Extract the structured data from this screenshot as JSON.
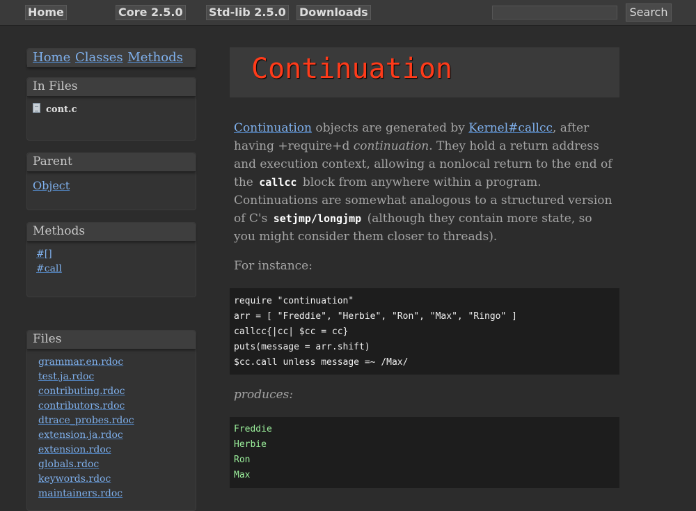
{
  "nav": {
    "home": "Home",
    "core": "Core 2.5.0",
    "stdlib": "Std-lib 2.5.0",
    "downloads": "Downloads",
    "search_button": "Search",
    "search_placeholder": ""
  },
  "sidebar": {
    "navlinks": {
      "home": "Home",
      "classes": "Classes",
      "methods": "Methods"
    },
    "in_files": {
      "title": "In Files",
      "file": "cont.c"
    },
    "parent": {
      "title": "Parent",
      "link": "Object"
    },
    "methods": {
      "title": "Methods",
      "items": [
        "#[]",
        "#call"
      ]
    },
    "files": {
      "title": "Files",
      "items": [
        "grammar.en.rdoc",
        "test.ja.rdoc",
        "contributing.rdoc",
        "contributors.rdoc",
        "dtrace_probes.rdoc",
        "extension.ja.rdoc",
        "extension.rdoc",
        "globals.rdoc",
        "keywords.rdoc",
        "maintainers.rdoc"
      ]
    }
  },
  "main": {
    "title": "Continuation",
    "desc": {
      "link1": "Continuation",
      "t1": " objects are generated by ",
      "link2": "Kernel#callcc",
      "t2": ", after having +require+d ",
      "em": "continuation",
      "t3": ". They hold a return address and execution context, allowing a nonlocal return to the end of the ",
      "code1": "callcc",
      "t4": " block from anywhere within a program. Continuations are somewhat analogous to a structured version of C's ",
      "code2": "setjmp/longjmp",
      "t5": " (although they contain more state, so you might consider them closer to threads)."
    },
    "for_instance": "For instance:",
    "code_lines": [
      "require \"continuation\"",
      "arr = [ \"Freddie\", \"Herbie\", \"Ron\", \"Max\", \"Ringo\" ]",
      "callcc{|cc| $cc = cc}",
      "puts(message = arr.shift)",
      "$cc.call unless message =~ /Max/"
    ],
    "produces": "produces:",
    "output_lines": [
      "Freddie",
      "Herbie",
      "Ron",
      "Max"
    ]
  }
}
